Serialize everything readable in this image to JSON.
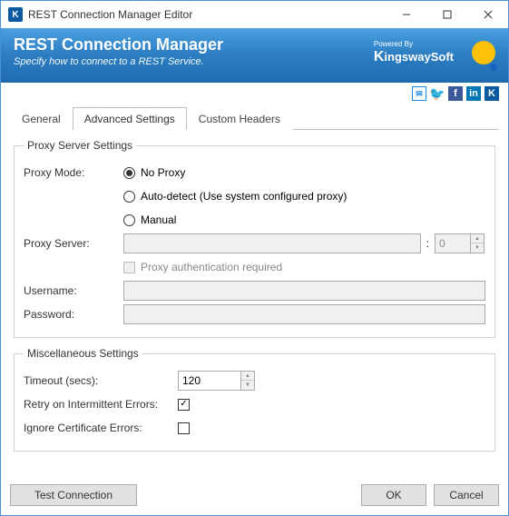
{
  "window": {
    "title": "REST Connection Manager Editor"
  },
  "banner": {
    "heading": "REST Connection Manager",
    "subtitle": "Specify how to connect to a REST Service.",
    "powered_by": "Powered By",
    "brand": "KingswaySoft"
  },
  "social": {
    "mail": "✉",
    "twitter": "🐦",
    "facebook": "f",
    "linkedin": "in",
    "ks": "K"
  },
  "tabs": {
    "general": "General",
    "advanced": "Advanced Settings",
    "custom_headers": "Custom Headers"
  },
  "proxy": {
    "legend": "Proxy Server Settings",
    "mode_label": "Proxy Mode:",
    "options": {
      "none": "No Proxy",
      "auto": "Auto-detect (Use system configured proxy)",
      "manual": "Manual"
    },
    "selected": "none",
    "server_label": "Proxy Server:",
    "server_value": "",
    "port_value": "0",
    "auth_required_label": "Proxy authentication required",
    "username_label": "Username:",
    "username_value": "",
    "password_label": "Password:",
    "password_value": ""
  },
  "misc": {
    "legend": "Miscellaneous Settings",
    "timeout_label": "Timeout (secs):",
    "timeout_value": "120",
    "retry_label": "Retry on Intermittent Errors:",
    "retry_checked": true,
    "ignore_cert_label": "Ignore Certificate Errors:",
    "ignore_cert_checked": false
  },
  "buttons": {
    "test": "Test Connection",
    "ok": "OK",
    "cancel": "Cancel"
  }
}
